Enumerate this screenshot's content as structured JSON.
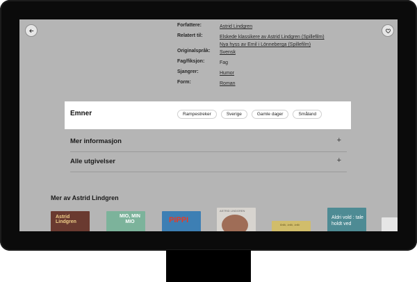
{
  "details": [
    {
      "label": "Forfattere:",
      "values": [
        "Astrid Lindgren"
      ],
      "linked": true
    },
    {
      "label": "Relatert til:",
      "values": [
        "Elskede klassikere av Astrid Lindgren (Spillefilm)",
        "Nya hyss av Emil i Lönneberga (Spillefilm)"
      ],
      "linked": true
    },
    {
      "label": "Originalspråk:",
      "values": [
        "Svensk"
      ],
      "linked": true
    },
    {
      "label": "Fag/fiksjon:",
      "values": [
        "Fag"
      ],
      "linked": false
    },
    {
      "label": "Sjangrer:",
      "values": [
        "Humor"
      ],
      "linked": true
    },
    {
      "label": "Form:",
      "values": [
        "Roman"
      ],
      "linked": true
    }
  ],
  "subjects": {
    "title": "Emner",
    "tags": [
      "Rampestreker",
      "Sverige",
      "Gamle dager",
      "Småland"
    ]
  },
  "accordions": [
    {
      "title": "Mer informasjon",
      "icon": "plus-icon"
    },
    {
      "title": "Alle utgivelser",
      "icon": "plus-icon"
    }
  ],
  "more_by": {
    "title": "Mer av Astrid Lindgren",
    "covers": [
      {
        "text": "Astrid Lindgren",
        "color": "#6a3a30"
      },
      {
        "text": "MIO, MIN MIO",
        "color": "#7cb39b"
      },
      {
        "text": "PIPPI",
        "color": "#3d7fb4"
      },
      {
        "text": "ASTRID LINDGREN",
        "color": "#d7d4cf"
      },
      {
        "text": "Bråk, bråk, bråk",
        "color": "#d1bd6b"
      },
      {
        "text": "Aldri vold : tale holdt ved",
        "color": "#4e8b94"
      }
    ]
  },
  "icons": {
    "back": "arrow-left-icon",
    "favorite": "heart-icon"
  }
}
